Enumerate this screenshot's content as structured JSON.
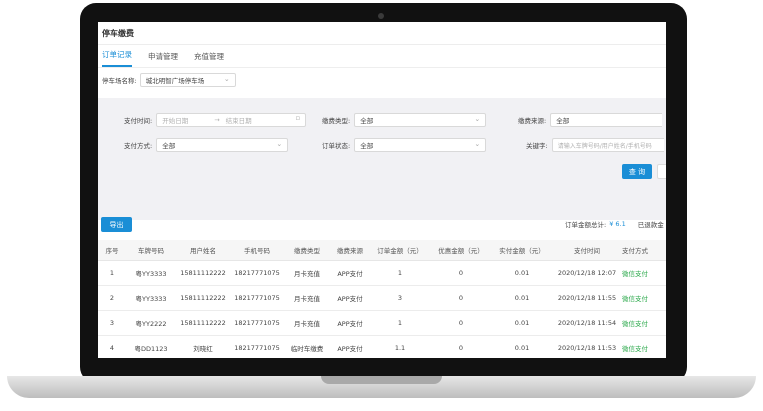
{
  "app": {
    "title": "停车缴费"
  },
  "tabs": [
    {
      "label": "订单记录",
      "active": true
    },
    {
      "label": "申请管理",
      "active": false
    },
    {
      "label": "充值管理",
      "active": false
    }
  ],
  "parking_lot": {
    "label": "停车场名称:",
    "value": "城北明智广场停车场"
  },
  "filters": {
    "pay_time": {
      "label": "支付时间:",
      "start_placeholder": "开始日期",
      "separator": "→",
      "end_placeholder": "结束日期"
    },
    "fee_type": {
      "label": "缴费类型:",
      "value": "全部"
    },
    "fee_source": {
      "label": "缴费来源:",
      "value": "全部"
    },
    "pay_method": {
      "label": "支付方式:",
      "value": "全部"
    },
    "order_status": {
      "label": "订单状态:",
      "value": "全部"
    },
    "keyword": {
      "label": "关键字:",
      "placeholder": "请输入车牌号码/用户姓名/手机号码"
    },
    "query_button": "查 询"
  },
  "toolbar": {
    "export_button": "导出",
    "total_label": "订单金额总计:",
    "total_value": "¥ 6.1",
    "refund_label": "已退款金"
  },
  "table": {
    "columns": [
      "序号",
      "车牌号码",
      "用户姓名",
      "手机号码",
      "缴费类型",
      "缴费来源",
      "订单金额（元）",
      "优惠金额（元）",
      "实付金额（元）",
      "支付时间",
      "支付方式"
    ],
    "rows": [
      [
        "1",
        "粤YY3333",
        "15811112222",
        "18217771075",
        "月卡充值",
        "APP支付",
        "1",
        "0",
        "0.01",
        "2020/12/18 12:07",
        "微信支付"
      ],
      [
        "2",
        "粤YY3333",
        "15811112222",
        "18217771075",
        "月卡充值",
        "APP支付",
        "3",
        "0",
        "0.01",
        "2020/12/18 11:55",
        "微信支付"
      ],
      [
        "3",
        "粤YY2222",
        "15811112222",
        "18217771075",
        "月卡充值",
        "APP支付",
        "1",
        "0",
        "0.01",
        "2020/12/18 11:54",
        "微信支付"
      ],
      [
        "4",
        "粤DD1123",
        "刘晓红",
        "18217771075",
        "临时车缴费",
        "APP支付",
        "1.1",
        "0",
        "0.01",
        "2020/12/18 11:53",
        "微信支付"
      ]
    ]
  },
  "colors": {
    "accent": "#1a8ed6",
    "pay_method_text": "#2aa84a",
    "filter_panel_bg": "#f1f1f4"
  }
}
